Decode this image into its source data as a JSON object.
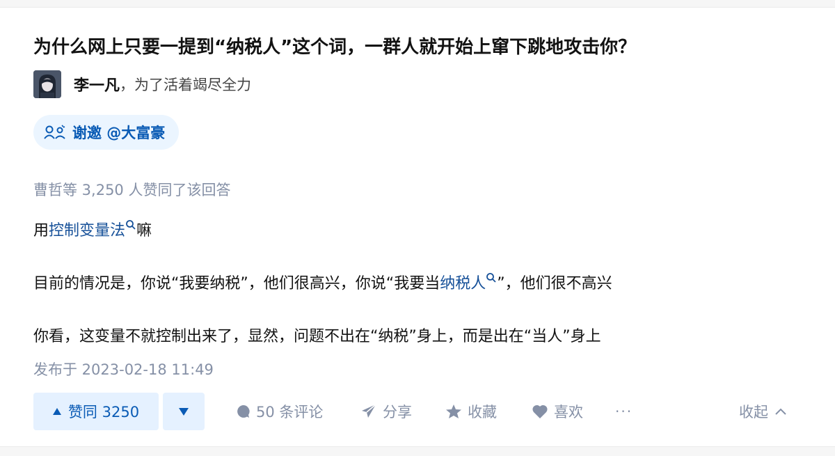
{
  "question": {
    "title": "为什么网上只要一提到“纳税人”这个词，一群人就开始上窜下跳地攻击你？"
  },
  "author": {
    "name": "李一凡",
    "bio": "，为了活着竭尽全力"
  },
  "invite": {
    "label": "谢邀 @大富豪"
  },
  "answer": {
    "votes_text": "曹哲等 3,250 人赞同了该回答",
    "p1_before": "用",
    "p1_link": "控制变量法",
    "p1_after": "嘛",
    "p2_before": "目前的情况是，你说“我要纳税”，他们很高兴，你说“我要当",
    "p2_link": "纳税人",
    "p2_after": "”，他们很不高兴",
    "p3": "你看，这变量不就控制出来了，显然，问题不出在“纳税”身上，而是出在“当人”身上",
    "published": "发布于 2023-02-18 11:49"
  },
  "actions": {
    "upvote_label": "赞同 3250",
    "comment_label": "50 条评论",
    "share_label": "分享",
    "collect_label": "收藏",
    "like_label": "喜欢",
    "more_label": "···",
    "collapse_label": "收起"
  },
  "colors": {
    "accent": "#0a5bb5",
    "link": "#175199",
    "muted": "#8590a6",
    "upvote_bg": "#e5f1ff"
  }
}
